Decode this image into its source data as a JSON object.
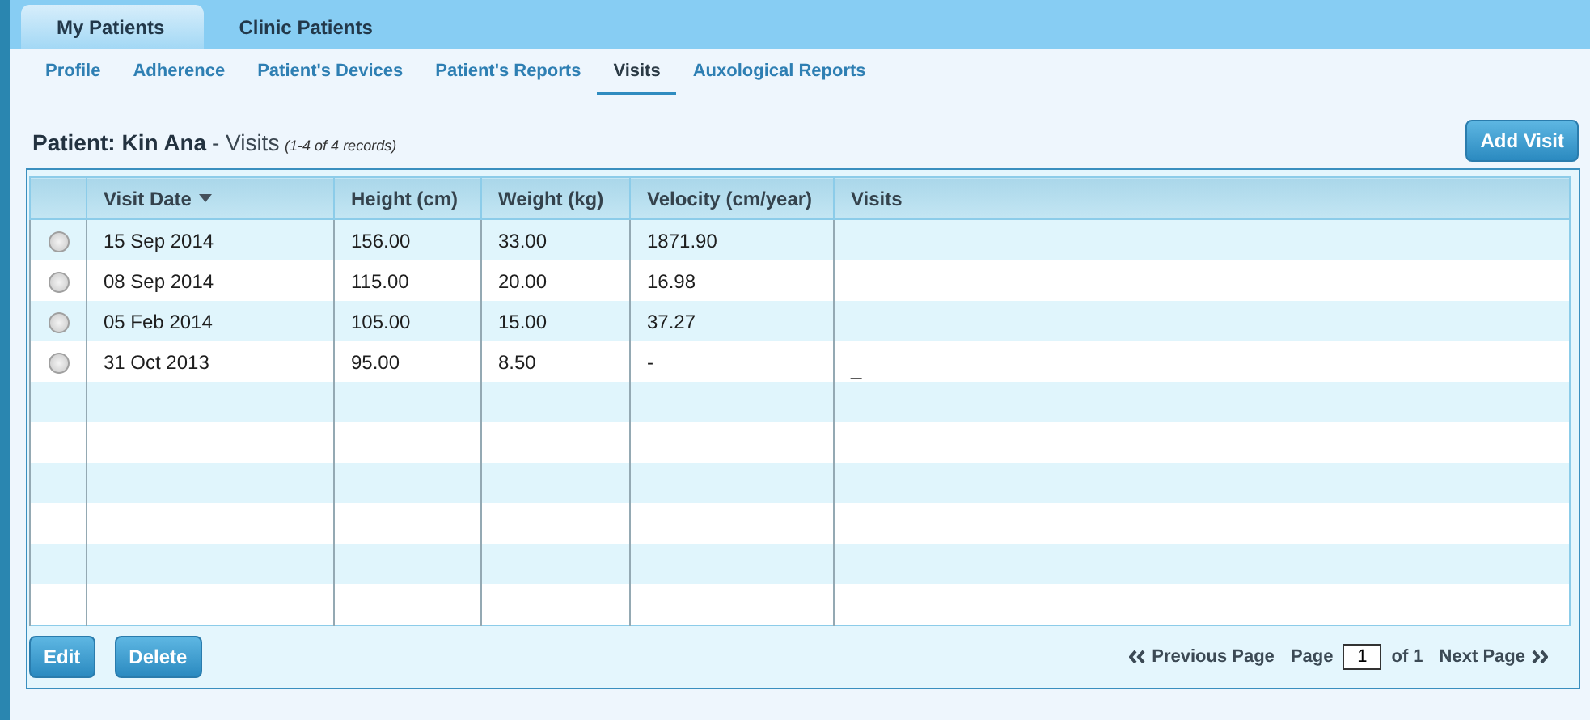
{
  "top_tabs": [
    {
      "label": "My Patients",
      "selected": true
    },
    {
      "label": "Clinic Patients",
      "selected": false
    }
  ],
  "sub_tabs": [
    {
      "label": "Profile",
      "selected": false
    },
    {
      "label": "Adherence",
      "selected": false
    },
    {
      "label": "Patient's Devices",
      "selected": false
    },
    {
      "label": "Patient's Reports",
      "selected": false
    },
    {
      "label": "Visits",
      "selected": true
    },
    {
      "label": "Auxological Reports",
      "selected": false
    }
  ],
  "heading": {
    "patient": "Patient: Kin Ana",
    "section": "- Visits",
    "records": "(1-4 of 4 records)"
  },
  "add_button": "Add Visit",
  "table": {
    "columns": [
      "Visit Date",
      "Height (cm)",
      "Weight (kg)",
      "Velocity (cm/year)",
      "Visits"
    ],
    "rows": [
      {
        "selected": false,
        "cells": [
          "15 Sep 2014",
          "156.00",
          "33.00",
          "1871.90",
          ""
        ]
      },
      {
        "selected": false,
        "cells": [
          "08 Sep 2014",
          "115.00",
          "20.00",
          "16.98",
          ""
        ]
      },
      {
        "selected": false,
        "cells": [
          "05 Feb 2014",
          "105.00",
          "15.00",
          "37.27",
          ""
        ]
      },
      {
        "selected": false,
        "cells": [
          "31 Oct 2013",
          "95.00",
          "8.50",
          "-",
          "_"
        ]
      }
    ]
  },
  "actions": [
    "Edit",
    "Delete"
  ],
  "pager": {
    "previous": "Previous Page",
    "page_label": "Page",
    "page": "1",
    "of": "of 1",
    "next": "Next Page"
  }
}
